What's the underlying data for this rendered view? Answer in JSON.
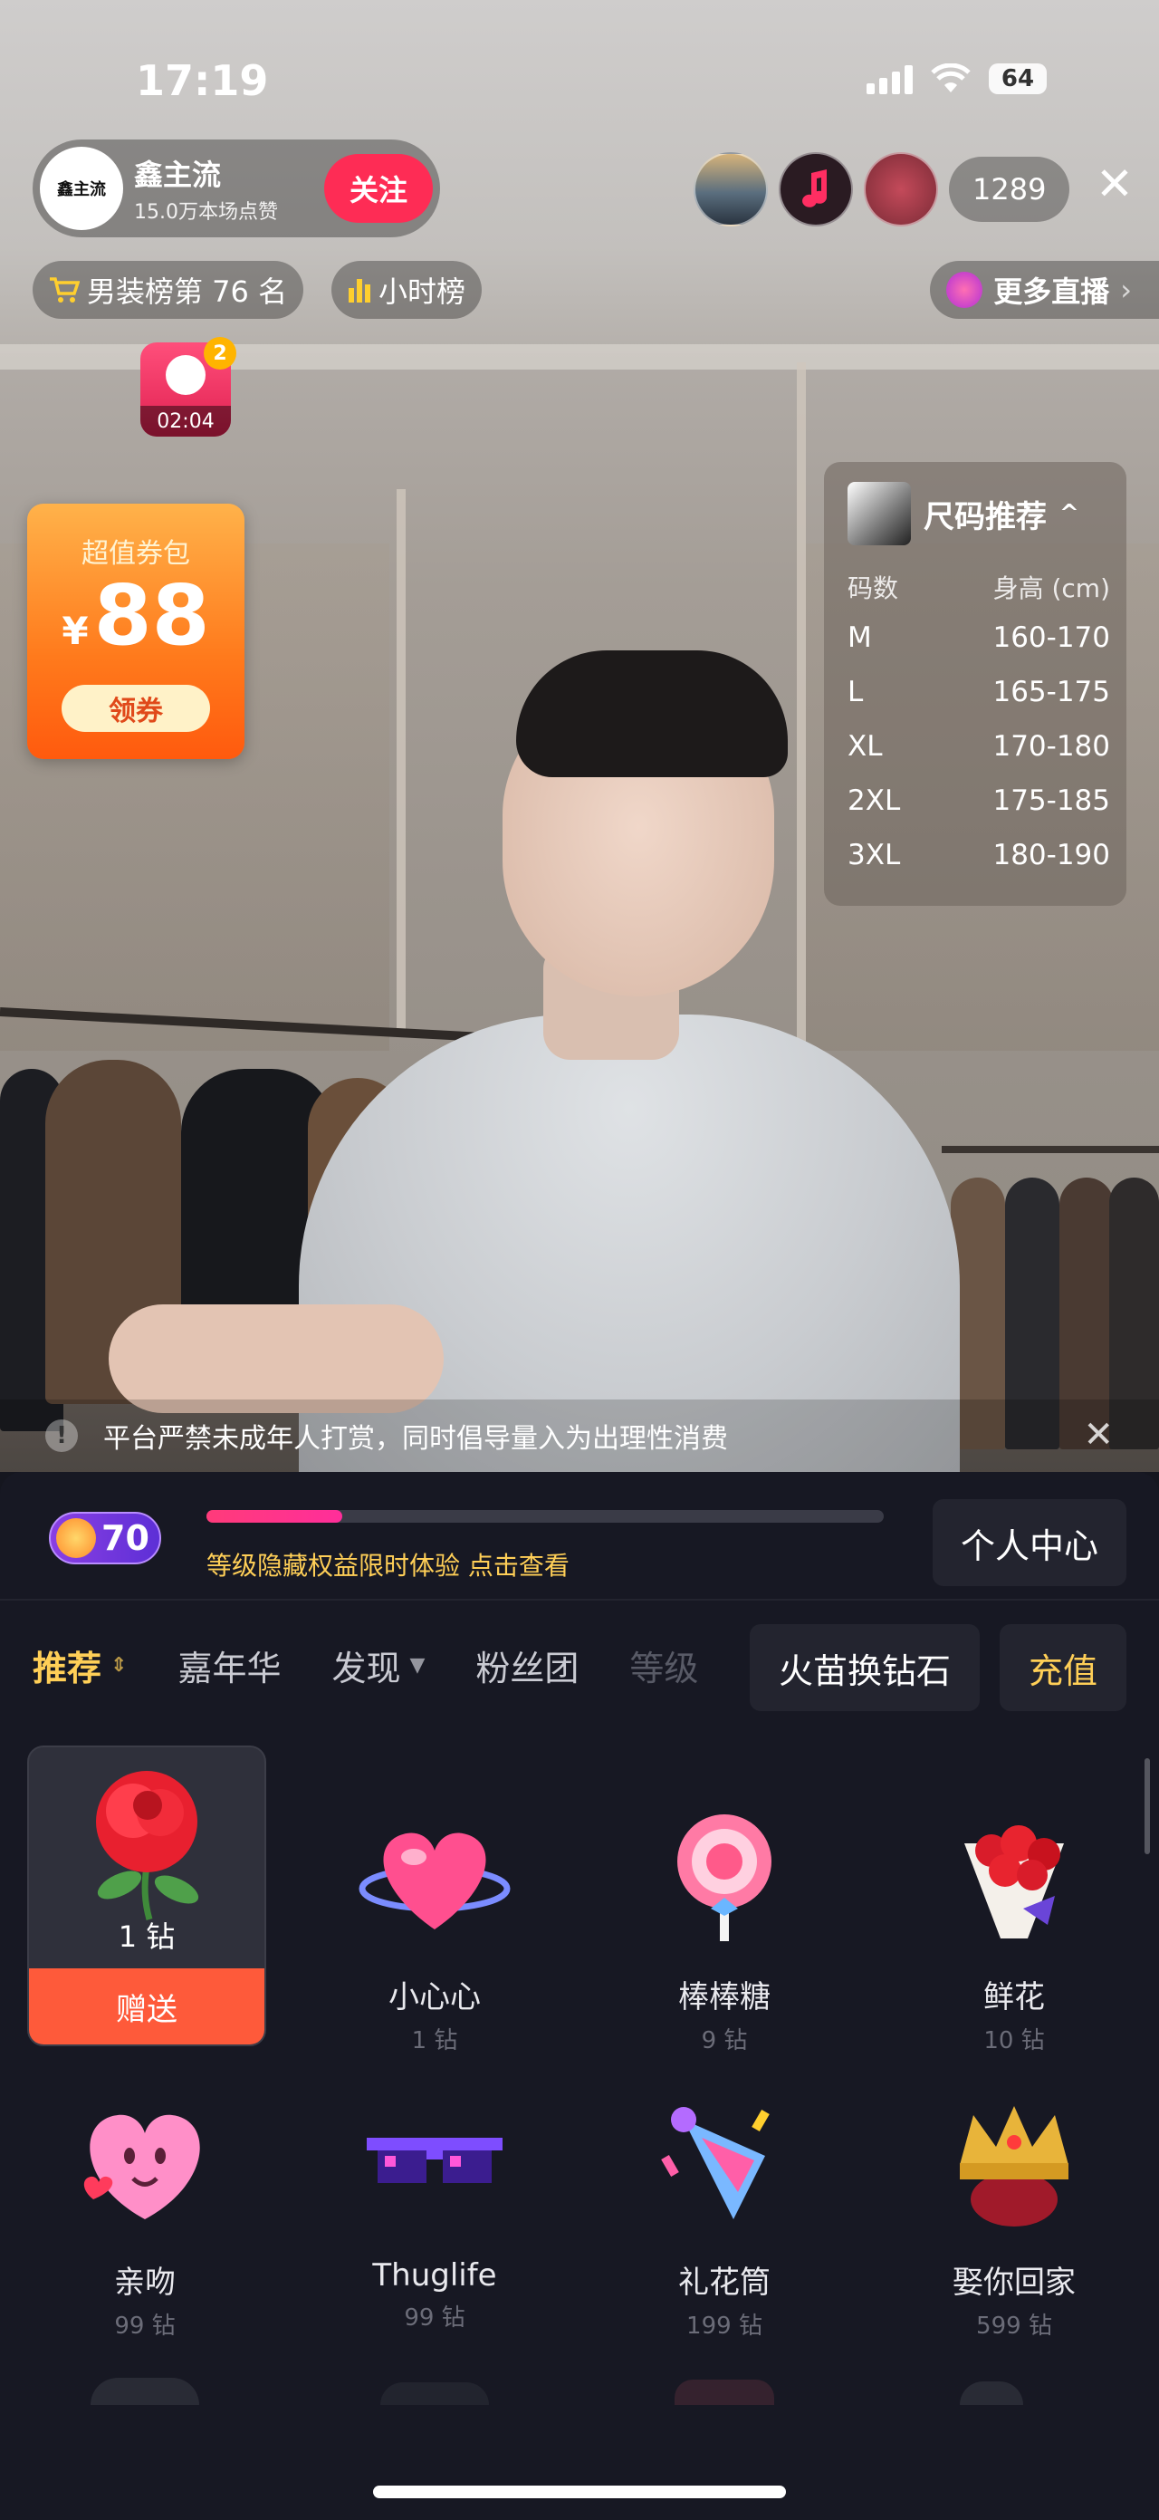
{
  "status": {
    "time": "17:19",
    "battery": "64"
  },
  "anchor": {
    "name": "鑫主流",
    "avatar_text": "鑫主流",
    "likes": "15.0万本场点赞",
    "follow_label": "关注"
  },
  "viewer_count": "1289",
  "rank": {
    "board_label": "男装榜第 76 名",
    "hour_label": "小时榜"
  },
  "more_live_label": "更多直播",
  "timer": {
    "badge_count": "2",
    "time": "02:04"
  },
  "coupon": {
    "title": "超值券包",
    "currency": "¥",
    "amount": "88",
    "button": "领券"
  },
  "size_card": {
    "title": "尺码推荐",
    "col_size": "码数",
    "col_height": "身高 (cm)",
    "rows": [
      {
        "size": "M",
        "height": "160-170"
      },
      {
        "size": "L",
        "height": "165-175"
      },
      {
        "size": "XL",
        "height": "170-180"
      },
      {
        "size": "2XL",
        "height": "175-185"
      },
      {
        "size": "3XL",
        "height": "180-190"
      }
    ]
  },
  "notice": "平台严禁未成年人打赏，同时倡导量入为出理性消费",
  "level": {
    "value": "70",
    "progress": 0.2,
    "text": "等级隐藏权益限时体验 点击查看",
    "center_label": "个人中心"
  },
  "tabs": {
    "items": [
      "推荐",
      "嘉年华",
      "发现",
      "粉丝团",
      "等级"
    ],
    "exchange": "火苗换钻石",
    "recharge": "充值"
  },
  "gifts": [
    {
      "name": "",
      "price": "1 钻",
      "send_label": "赠送",
      "icon": "rose-icon"
    },
    {
      "name": "小心心",
      "price": "1 钻",
      "icon": "heart-icon"
    },
    {
      "name": "棒棒糖",
      "price": "9 钻",
      "icon": "lollipop-icon"
    },
    {
      "name": "鲜花",
      "price": "10 钻",
      "icon": "bouquet-icon"
    },
    {
      "name": "亲吻",
      "price": "99 钻",
      "icon": "kiss-icon"
    },
    {
      "name": "Thuglife",
      "price": "99 钻",
      "icon": "sunglasses-icon"
    },
    {
      "name": "礼花筒",
      "price": "199 钻",
      "icon": "party-popper-icon"
    },
    {
      "name": "娶你回家",
      "price": "599 钻",
      "icon": "crown-icon"
    }
  ],
  "colors": {
    "accent": "#fe2c55",
    "gold": "#ffcf57",
    "send": "#fe5a3a",
    "panel": "#171823"
  }
}
